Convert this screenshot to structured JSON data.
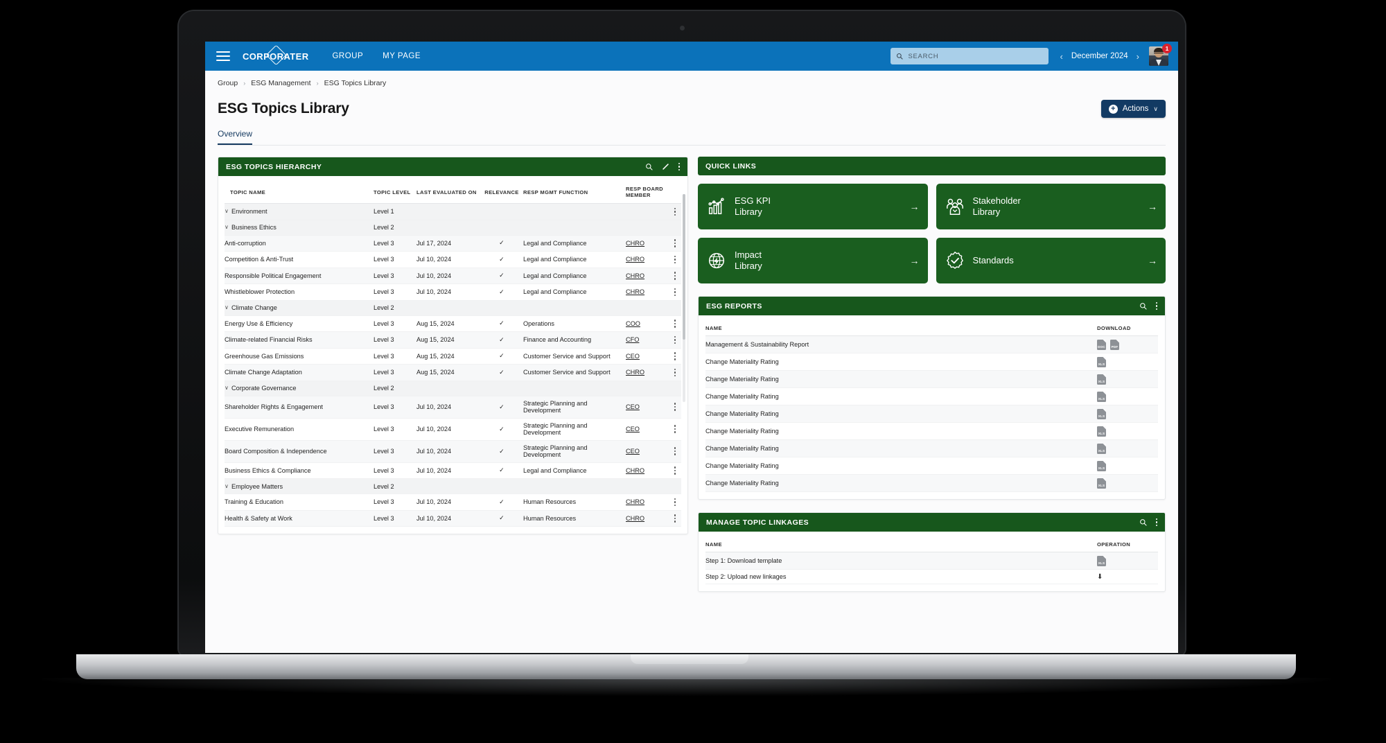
{
  "navbar": {
    "brand": "CORPORATER",
    "links": [
      "GROUP",
      "MY PAGE"
    ],
    "search_placeholder": "SEARCH",
    "prev_label": "‹",
    "period": "December 2024",
    "next_label": "›",
    "notification_count": "1"
  },
  "breadcrumb": [
    "Group",
    "ESG Management",
    "ESG Topics Library"
  ],
  "page": {
    "title": "ESG Topics Library",
    "actions_label": "Actions",
    "actions_plus": "+",
    "actions_caret": "∨",
    "tab": "Overview"
  },
  "hierarchy": {
    "title": "ESG TOPICS HIERARCHY",
    "columns": [
      "TOPIC NAME",
      "TOPIC LEVEL",
      "LAST EVALUATED ON",
      "RELEVANCE",
      "RESP MGMT FUNCTION",
      "RESP BOARD MEMBER"
    ],
    "rows": [
      {
        "name": "Environment",
        "indent": 1,
        "caret": "∨",
        "level": "Level 1",
        "date": "",
        "relevance": "",
        "fn": "",
        "board": "",
        "kebab": true
      },
      {
        "name": "Business Ethics",
        "indent": 2,
        "caret": "∨",
        "level": "Level 2",
        "date": "",
        "relevance": "",
        "fn": "",
        "board": "",
        "kebab": false
      },
      {
        "name": "Anti-corruption",
        "indent": 3,
        "caret": "",
        "level": "Level 3",
        "date": "Jul 17, 2024",
        "relevance": "✓",
        "fn": "Legal and Compliance",
        "board": "CHRO",
        "kebab": true
      },
      {
        "name": "Competition & Anti-Trust",
        "indent": 3,
        "caret": "",
        "level": "Level 3",
        "date": "Jul 10, 2024",
        "relevance": "✓",
        "fn": "Legal and Compliance",
        "board": "CHRO",
        "kebab": true
      },
      {
        "name": "Responsible Political Engagement",
        "indent": 3,
        "caret": "",
        "level": "Level 3",
        "date": "Jul 10, 2024",
        "relevance": "✓",
        "fn": "Legal and Compliance",
        "board": "CHRO",
        "kebab": true
      },
      {
        "name": "Whistleblower Protection",
        "indent": 3,
        "caret": "",
        "level": "Level 3",
        "date": "Jul 10, 2024",
        "relevance": "✓",
        "fn": "Legal and Compliance",
        "board": "CHRO",
        "kebab": true
      },
      {
        "name": "Climate Change",
        "indent": 2,
        "caret": "∨",
        "level": "Level 2",
        "date": "",
        "relevance": "",
        "fn": "",
        "board": "",
        "kebab": false
      },
      {
        "name": "Energy Use & Efficiency",
        "indent": 3,
        "caret": "",
        "level": "Level 3",
        "date": "Aug 15, 2024",
        "relevance": "✓",
        "fn": "Operations",
        "board": "COO",
        "kebab": true
      },
      {
        "name": "Climate-related Financial Risks",
        "indent": 3,
        "caret": "",
        "level": "Level 3",
        "date": "Aug 15, 2024",
        "relevance": "✓",
        "fn": "Finance and Accounting",
        "board": "CFO",
        "kebab": true
      },
      {
        "name": "Greenhouse Gas Emissions",
        "indent": 3,
        "caret": "",
        "level": "Level 3",
        "date": "Aug 15, 2024",
        "relevance": "✓",
        "fn": "Customer Service and Support",
        "board": "CEO",
        "kebab": true
      },
      {
        "name": "Climate Change Adaptation",
        "indent": 3,
        "caret": "",
        "level": "Level 3",
        "date": "Aug 15, 2024",
        "relevance": "✓",
        "fn": "Customer Service and Support",
        "board": "CHRO",
        "kebab": true
      },
      {
        "name": "Corporate Governance",
        "indent": 2,
        "caret": "∨",
        "level": "Level 2",
        "date": "",
        "relevance": "",
        "fn": "",
        "board": "",
        "kebab": false
      },
      {
        "name": "Shareholder Rights & Engagement",
        "indent": 3,
        "caret": "",
        "level": "Level 3",
        "date": "Jul 10, 2024",
        "relevance": "✓",
        "fn": "Strategic Planning and Development",
        "board": "CEO",
        "kebab": true
      },
      {
        "name": "Executive Remuneration",
        "indent": 3,
        "caret": "",
        "level": "Level 3",
        "date": "Jul 10, 2024",
        "relevance": "✓",
        "fn": "Strategic Planning and Development",
        "board": "CEO",
        "kebab": true
      },
      {
        "name": "Board Composition & Independence",
        "indent": 3,
        "caret": "",
        "level": "Level 3",
        "date": "Jul 10, 2024",
        "relevance": "✓",
        "fn": "Strategic Planning and Development",
        "board": "CEO",
        "kebab": true
      },
      {
        "name": "Business Ethics & Compliance",
        "indent": 3,
        "caret": "",
        "level": "Level 3",
        "date": "Jul 10, 2024",
        "relevance": "✓",
        "fn": "Legal and Compliance",
        "board": "CHRO",
        "kebab": true
      },
      {
        "name": "Employee Matters",
        "indent": 2,
        "caret": "∨",
        "level": "Level 2",
        "date": "",
        "relevance": "",
        "fn": "",
        "board": "",
        "kebab": false
      },
      {
        "name": "Training & Education",
        "indent": 3,
        "caret": "",
        "level": "Level 3",
        "date": "Jul 10, 2024",
        "relevance": "✓",
        "fn": "Human Resources",
        "board": "CHRO",
        "kebab": true
      },
      {
        "name": "Health & Safety at Work",
        "indent": 3,
        "caret": "",
        "level": "Level 3",
        "date": "Jul 10, 2024",
        "relevance": "✓",
        "fn": "Human Resources",
        "board": "CHRO",
        "kebab": true
      }
    ]
  },
  "quick_links": {
    "title": "QUICK LINKS",
    "tiles": [
      {
        "label": "ESG KPI\nLibrary",
        "icon": "bar-chart-trend-icon",
        "arrow": "→"
      },
      {
        "label": "Stakeholder\nLibrary",
        "icon": "people-group-icon",
        "arrow": "→"
      },
      {
        "label": "Impact\nLibrary",
        "icon": "globe-bolt-icon",
        "arrow": "→"
      },
      {
        "label": "Standards",
        "icon": "certified-badge-icon",
        "arrow": "→"
      }
    ]
  },
  "reports": {
    "title": "ESG REPORTS",
    "columns": [
      "NAME",
      "DOWNLOAD"
    ],
    "rows": [
      {
        "name": "Management & Sustainability Report",
        "files": [
          "DOC",
          "PDF"
        ]
      },
      {
        "name": "Change Materiality Rating",
        "files": [
          "XLS"
        ]
      },
      {
        "name": "Change Materiality Rating",
        "files": [
          "XLS"
        ]
      },
      {
        "name": "Change Materiality Rating",
        "files": [
          "XLS"
        ]
      },
      {
        "name": "Change Materiality Rating",
        "files": [
          "XLS"
        ]
      },
      {
        "name": "Change Materiality Rating",
        "files": [
          "XLS"
        ]
      },
      {
        "name": "Change Materiality Rating",
        "files": [
          "XLS"
        ]
      },
      {
        "name": "Change Materiality Rating",
        "files": [
          "XLS"
        ]
      },
      {
        "name": "Change Materiality Rating",
        "files": [
          "XLS"
        ]
      }
    ]
  },
  "linkages": {
    "title": "MANAGE TOPIC LINKAGES",
    "columns": [
      "NAME",
      "OPERATION"
    ],
    "rows": [
      {
        "name": "Step 1: Download template",
        "op_type": "file",
        "op": "XLS"
      },
      {
        "name": "Step 2: Upload new linkages",
        "op_type": "icon",
        "op": "⬇"
      }
    ]
  },
  "colors": {
    "nav_blue": "#0b72ba",
    "card_green": "#17571c",
    "tile_green": "#1a5e1f",
    "actions_navy": "#123a63",
    "badge_red": "#d9232e"
  }
}
